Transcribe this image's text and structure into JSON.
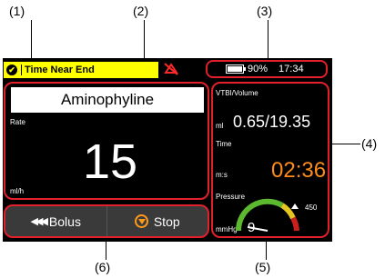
{
  "callouts": [
    "(1)",
    "(2)",
    "(3)",
    "(4)",
    "(5)",
    "(6)"
  ],
  "status_bar": {
    "alarm_text": "Time Near End",
    "battery_percent": "90%",
    "battery_level": 0.9,
    "clock": "17:34"
  },
  "drug_panel": {
    "drug_name": "Aminophyline",
    "rate_label": "Rate",
    "rate_value": "15",
    "rate_unit": "ml/h"
  },
  "info_panel": {
    "vtbi_label": "VTBI/Volume",
    "vtbi_unit": "ml",
    "vtbi_value": "0.65/19.35",
    "time_label": "Time",
    "time_unit": "m:s",
    "time_value": "02:36",
    "pressure_label": "Pressure",
    "pressure_unit": "mmHg",
    "pressure_value": "9",
    "pressure_limit": "450"
  },
  "buttons": {
    "bolus_label": "Bolus",
    "stop_label": "Stop"
  },
  "colors": {
    "highlight": "#e2202b",
    "alarm": "#ffff00",
    "time": "#ff8c1a"
  }
}
